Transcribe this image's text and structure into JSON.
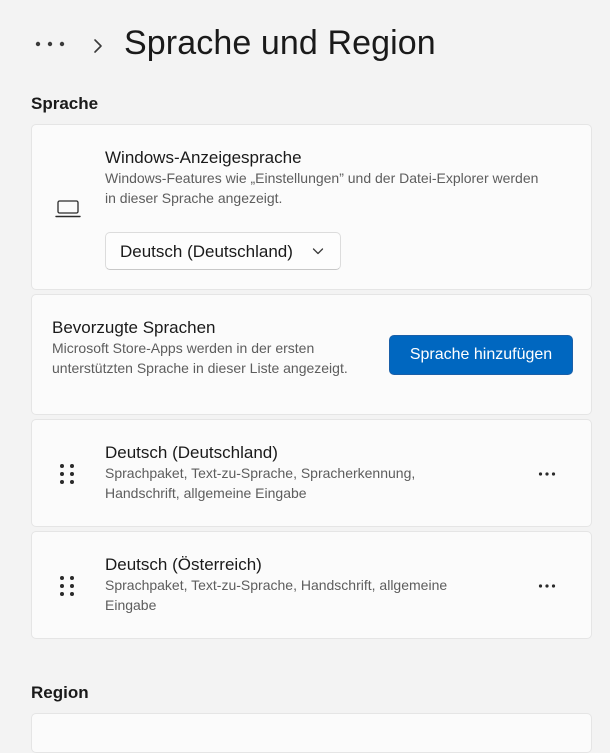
{
  "header": {
    "more_icon": "more-horizontal-icon",
    "breadcrumb_separator_icon": "chevron-right-icon",
    "title": "Sprache und Region"
  },
  "language_section": {
    "title": "Sprache",
    "display_language": {
      "icon": "laptop-icon",
      "title": "Windows-Anzeigesprache",
      "description": "Windows-Features wie „Einstellungen” und der Datei-Explorer werden in dieser Sprache angezeigt.",
      "selected_value": "Deutsch (Deutschland)"
    },
    "preferred_languages": {
      "title": "Bevorzugte Sprachen",
      "description": "Microsoft Store-Apps werden in der ersten unterstützten Sprache in dieser Liste angezeigt.",
      "add_button_label": "Sprache hinzufügen"
    },
    "languages": [
      {
        "name": "Deutsch (Deutschland)",
        "features": "Sprachpaket, Text-zu-Sprache, Spracherkennung, Handschrift, allgemeine Eingabe"
      },
      {
        "name": "Deutsch (Österreich)",
        "features": "Sprachpaket, Text-zu-Sprache, Handschrift, allgemeine Eingabe"
      }
    ]
  },
  "region_section": {
    "title": "Region"
  },
  "colors": {
    "accent": "#0067c0",
    "background": "#f3f3f3",
    "card": "#fbfbfb"
  }
}
